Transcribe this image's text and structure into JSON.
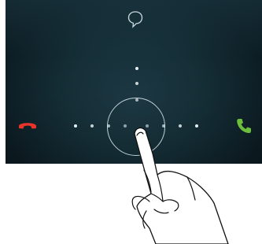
{
  "screen": {
    "icons": {
      "message": "message-bubble-icon",
      "decline": "phone-decline-icon",
      "answer": "phone-answer-icon"
    },
    "colors": {
      "decline": "#e8352b",
      "answer": "#6bbf3b",
      "background": "#163039"
    }
  }
}
